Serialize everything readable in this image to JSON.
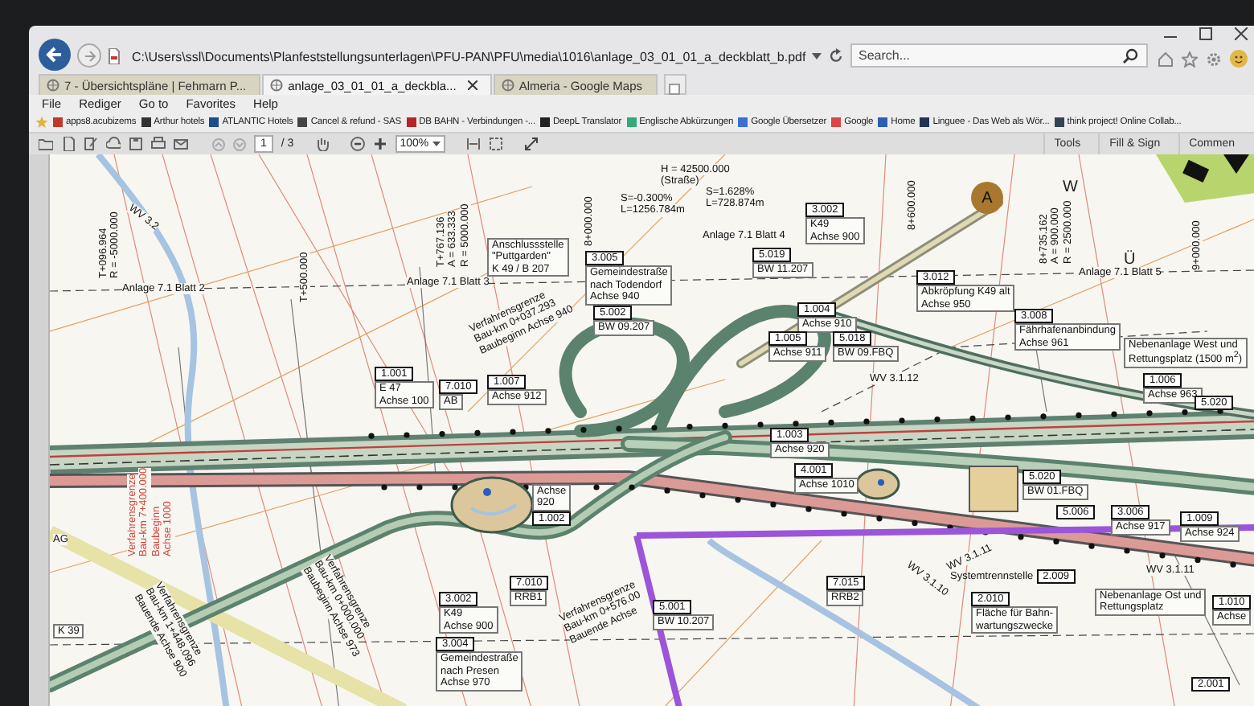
{
  "window": {
    "address": "C:\\Users\\ssl\\Documents\\Planfeststellungsunterlagen\\PFU-PAN\\PFU\\media\\1016\\anlage_03_01_01_a_deckblatt_b.pdf",
    "search_placeholder": "Search..."
  },
  "tabs": [
    {
      "label": "7 - Übersichtspläne | Fehmarn P...",
      "selected": false
    },
    {
      "label": "anlage_03_01_01_a_deckbla...",
      "selected": true
    },
    {
      "label": "Almeria - Google Maps",
      "selected": false
    }
  ],
  "menu": [
    "File",
    "Rediger",
    "Go to",
    "Favorites",
    "Help"
  ],
  "favorites": [
    "apps8.acubizems",
    "Arthur hotels",
    "ATLANTIC Hotels",
    "Cancel & refund - SAS",
    "DB BAHN - Verbindungen -...",
    "DeepL Translator",
    "Englische Abkürzungen",
    "Google Übersetzer",
    "Google",
    "Home",
    "Linguee - Das Web als Wör...",
    "think project! Online Collab..."
  ],
  "pdf_toolbar": {
    "page": "1",
    "page_count": "/ 3",
    "zoom": "100%",
    "panes": [
      "Tools",
      "Fill & Sign",
      "Commen"
    ]
  },
  "plan": {
    "markers": [
      {
        "kind": "circle",
        "text": "A"
      },
      {
        "kind": "letter",
        "text": "W"
      },
      {
        "kind": "letter",
        "text": "Ü"
      }
    ],
    "labels": [
      {
        "kind": "tilt-down",
        "lines": [
          "WV 3.2"
        ]
      },
      {
        "kind": "vertical",
        "lines": [
          "T+096.964",
          "R = -5000.000"
        ]
      },
      {
        "kind": "vertical",
        "lines": [
          "T+500.000"
        ]
      },
      {
        "kind": "vertical",
        "lines": [
          "T+767.136",
          "A = 633.333",
          "R = 5000.000"
        ]
      },
      {
        "kind": "vertical",
        "lines": [
          "8+000.000"
        ]
      },
      {
        "kind": "plain",
        "lines": [
          "H = 42500.000",
          "(Straße)"
        ]
      },
      {
        "kind": "plain",
        "lines": [
          "S=-0.300%",
          "L=1256.784m"
        ]
      },
      {
        "kind": "plain",
        "lines": [
          "S=1.628%",
          "L=728.874m"
        ]
      },
      {
        "kind": "vertical",
        "lines": [
          "8+600.000"
        ]
      },
      {
        "kind": "vertical",
        "lines": [
          "8+735.162",
          "A = 900.000",
          "R = 2500.000"
        ]
      },
      {
        "kind": "vertical",
        "lines": [
          "9+000.000"
        ]
      },
      {
        "kind": "note",
        "lines": [
          "Anschlussstelle",
          "\"Puttgarden\"",
          "K 49 / B 207"
        ]
      },
      {
        "kind": "plain",
        "lines": [
          "Anlage 7.1 Blatt 2"
        ]
      },
      {
        "kind": "plain",
        "lines": [
          "Anlage 7.1 Blatt 3"
        ]
      },
      {
        "kind": "plain",
        "lines": [
          "Anlage 7.1 Blatt 4"
        ]
      },
      {
        "kind": "tag",
        "code": "3.005",
        "lines": [
          "Gemeindestraße",
          "nach Todendorf",
          "Achse 940"
        ]
      },
      {
        "kind": "tag",
        "code": "5.002",
        "lines": [
          "BW 09.207"
        ]
      },
      {
        "kind": "tag",
        "code": "3.002",
        "lines": [
          "K49",
          "Achse 900"
        ]
      },
      {
        "kind": "tag",
        "code": "5.019",
        "lines": [
          "BW 11.207"
        ]
      },
      {
        "kind": "tilt-up",
        "lines": [
          "Verfahrensgrenze",
          "Bau-km 0+037.293",
          "Baubeginn Achse 940"
        ]
      },
      {
        "kind": "tag",
        "code": "1.001",
        "lines": [
          "E 47",
          "Achse 100"
        ]
      },
      {
        "kind": "tag",
        "code": "7.010",
        "lines": [
          "AB"
        ]
      },
      {
        "kind": "tag",
        "code": "1.007",
        "lines": [
          "Achse 912"
        ]
      },
      {
        "kind": "tag",
        "code": "1.004",
        "lines": [
          "Achse 910"
        ]
      },
      {
        "kind": "tag",
        "code": "1.005",
        "lines": [
          "Achse 911"
        ]
      },
      {
        "kind": "tag",
        "code": "5.018",
        "lines": [
          "BW 09.FBQ"
        ]
      },
      {
        "kind": "tag",
        "code": "3.012",
        "lines": [
          "Abkröpfung K49 alt",
          "Achse 950"
        ]
      },
      {
        "kind": "plain",
        "lines": [
          "Anlage 7.1 Blatt 5"
        ]
      },
      {
        "kind": "tag",
        "code": "3.008",
        "lines": [
          "Fährhafenanbindung",
          "Achse 961"
        ]
      },
      {
        "kind": "note",
        "lines": [
          "Nebenanlage West und",
          "Rettungsplatz (1500 m$^{2}$)"
        ]
      },
      {
        "kind": "tag",
        "code": "1.006",
        "lines": [
          "Achse 963"
        ]
      },
      {
        "kind": "tag",
        "code": "5.020"
      },
      {
        "kind": "plain",
        "lines": [
          "WV 3.1.12"
        ]
      },
      {
        "kind": "tag",
        "code": "1.003",
        "lines": [
          "Achse 920"
        ]
      },
      {
        "kind": "tag",
        "code": "4.001",
        "lines": [
          "Achse 1010"
        ]
      },
      {
        "kind": "tag",
        "code": "5.020",
        "lines": [
          "BW 01.FBQ"
        ]
      },
      {
        "kind": "tag",
        "code": "5.006"
      },
      {
        "kind": "tag",
        "code": "3.006",
        "lines": [
          "Achse 917"
        ]
      },
      {
        "kind": "tag",
        "code": "1.009",
        "lines": [
          "Achse 924"
        ]
      },
      {
        "kind": "tag-below",
        "code": "1.002",
        "lines": [
          "Achse",
          "920"
        ]
      },
      {
        "kind": "plain",
        "lines": [
          "AG"
        ]
      },
      {
        "kind": "vertical",
        "color": "#d2463c",
        "lines": [
          "Verfahrensgrenze",
          "Bau-km 7+400.000",
          "Baubeginn",
          "Achse 1000"
        ]
      },
      {
        "kind": "steep",
        "lines": [
          "Verfahrensgrenze",
          "Bau-km 1+448.096",
          "Bauende Achse 900"
        ]
      },
      {
        "kind": "note",
        "lines": [
          "K 39"
        ]
      },
      {
        "kind": "steep",
        "lines": [
          "Verfahrensgrenze",
          "Bau-km 0+000.000",
          "Baubeginn Achse 973"
        ]
      },
      {
        "kind": "tag",
        "code": "3.002",
        "lines": [
          "K49",
          "Achse 900"
        ]
      },
      {
        "kind": "tag",
        "code": "7.010",
        "lines": [
          "RRB1"
        ]
      },
      {
        "kind": "tilt-up",
        "lines": [
          "Verfahrensgrenze",
          "Bau-km 0+576.00",
          "Bauende Achse"
        ]
      },
      {
        "kind": "tag",
        "code": "3.004",
        "lines": [
          "Gemeindestraße",
          "nach Presen",
          "Achse 970"
        ]
      },
      {
        "kind": "tag",
        "code": "5.001",
        "lines": [
          "BW 10.207"
        ]
      },
      {
        "kind": "tag",
        "code": "7.015",
        "lines": [
          "RRB2"
        ]
      },
      {
        "kind": "tag-after",
        "code": "2.009",
        "lines": [
          "Systemtrennstelle"
        ]
      },
      {
        "kind": "tag",
        "code": "2.010",
        "lines": [
          "Fläche für Bahn-",
          "wartungszwecke"
        ]
      },
      {
        "kind": "note",
        "lines": [
          "Nebenanlage Ost und",
          "Rettungsplatz"
        ]
      },
      {
        "kind": "tag",
        "code": "1.010",
        "lines": [
          "Achse"
        ]
      },
      {
        "kind": "tag",
        "code": "2.001"
      },
      {
        "kind": "tilt-up",
        "lines": [
          "WV 3.1.11"
        ]
      },
      {
        "kind": "tilt-down",
        "lines": [
          "WV 3.1.10"
        ]
      },
      {
        "kind": "plain",
        "lines": [
          "WV 3.1.11"
        ]
      }
    ]
  }
}
